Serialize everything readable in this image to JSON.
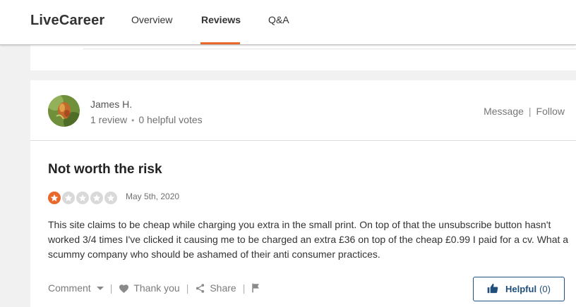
{
  "header": {
    "brand": "LiveCareer",
    "tabs": [
      {
        "label": "Overview",
        "active": false
      },
      {
        "label": "Reviews",
        "active": true
      },
      {
        "label": "Q&A",
        "active": false
      }
    ],
    "accent_color": "#e8692b"
  },
  "review": {
    "author": {
      "name": "James H.",
      "review_count": "1 review",
      "separator": "•",
      "helpful_votes": "0 helpful votes"
    },
    "actions": {
      "message": "Message",
      "separator": "|",
      "follow": "Follow"
    },
    "title": "Not worth the risk",
    "rating": {
      "value": 1,
      "max": 5
    },
    "date": "May 5th, 2020",
    "body": "This site claims to be cheap while charging you extra in the small print. On top of that the unsubscribe button hasn't worked 3/4 times I've clicked it causing me to be charged an extra £36 on top of the cheap £0.99 I paid for a cv. What a scummy company who should be ashamed of their anti consumer practices.",
    "footer": {
      "comment": "Comment",
      "thank_you": "Thank you",
      "share": "Share",
      "separator": "|",
      "helpful_label": "Helpful",
      "helpful_count": "(0)"
    }
  }
}
